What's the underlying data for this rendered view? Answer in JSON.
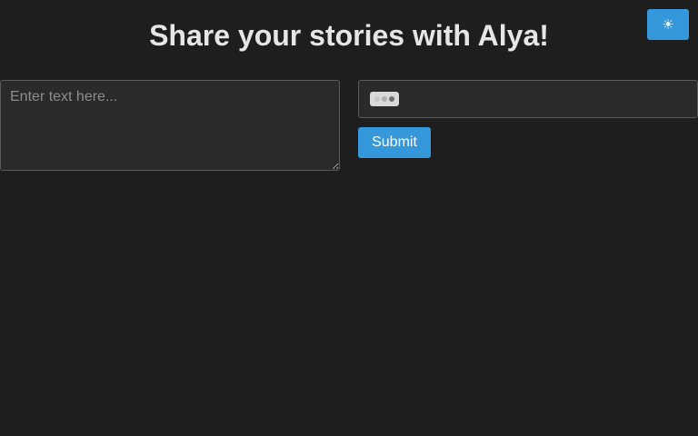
{
  "header": {
    "title": "Share your stories with Alya!",
    "theme_toggle_icon": "☀"
  },
  "story_input": {
    "value": "",
    "placeholder": "Enter text here..."
  },
  "response": {
    "icon": "typing-indicator-icon"
  },
  "actions": {
    "submit_label": "Submit"
  },
  "colors": {
    "background": "#1e1e1e",
    "panel": "#2a2a2a",
    "accent": "#3498db",
    "text": "#e6e6e6"
  }
}
